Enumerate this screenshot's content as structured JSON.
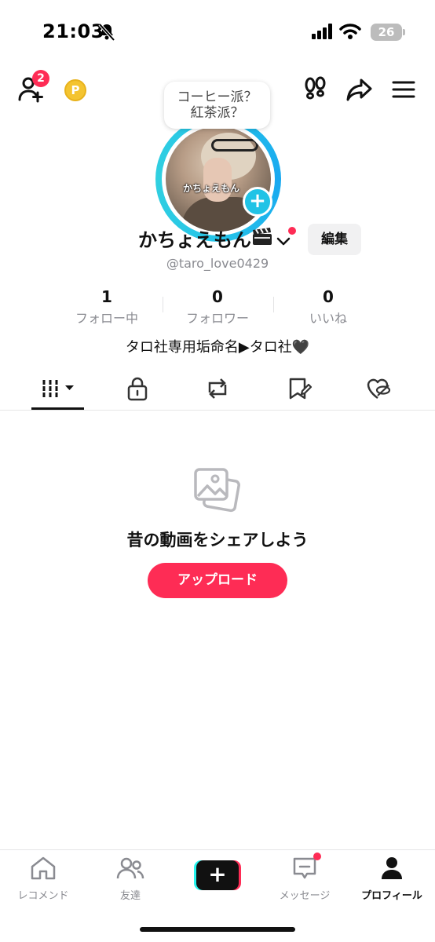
{
  "status_bar": {
    "time": "21:03",
    "battery": "26"
  },
  "header": {
    "friend_badge": "2",
    "coin_label": "P"
  },
  "profile": {
    "bubble_line1": "コーヒー派？",
    "bubble_line2": "紅茶派？",
    "avatar_overlay": "かちょえもん",
    "display_name": "かちょえもん",
    "edit_label": "編集",
    "handle": "@taro_love0429",
    "bio": "タロ社専用垢命名▶タロ社🖤"
  },
  "stats": [
    {
      "value": "1",
      "label": "フォロー中"
    },
    {
      "value": "0",
      "label": "フォロワー"
    },
    {
      "value": "0",
      "label": "いいね"
    }
  ],
  "tabs": [
    "videos-grid",
    "private",
    "reposts",
    "favorites",
    "liked"
  ],
  "empty_state": {
    "title": "昔の動画をシェアしよう",
    "upload_label": "アップロード"
  },
  "nav": [
    {
      "label": "レコメンド",
      "icon": "home-icon"
    },
    {
      "label": "友達",
      "icon": "friends-icon"
    },
    {
      "label": "+",
      "icon": "create-icon"
    },
    {
      "label": "メッセージ",
      "icon": "inbox-icon"
    },
    {
      "label": "プロフィール",
      "icon": "profile-icon"
    }
  ],
  "colors": {
    "accent": "#fe2c55",
    "ring": "#25c4e8",
    "muted": "#8a8b91"
  }
}
